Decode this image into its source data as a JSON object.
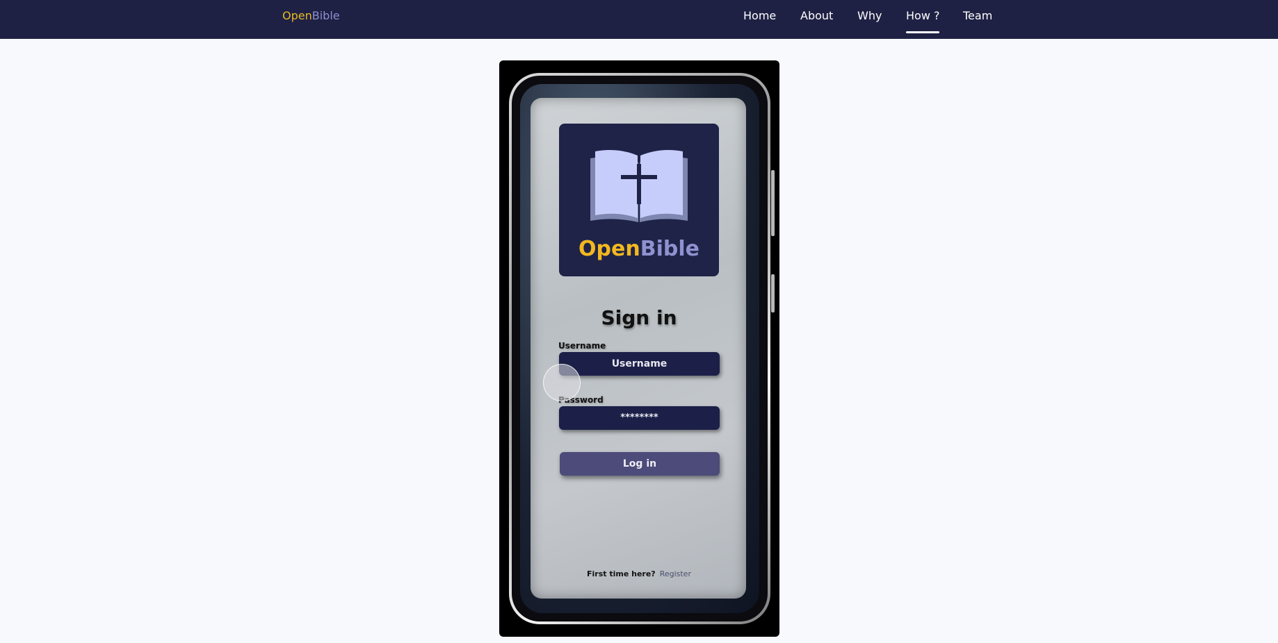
{
  "navbar": {
    "brand_part1": "Open",
    "brand_part2": "Bible",
    "links": [
      {
        "label": "Home"
      },
      {
        "label": "About"
      },
      {
        "label": "Why"
      },
      {
        "label": "How ?"
      },
      {
        "label": "Team"
      }
    ],
    "active_link": "How ?"
  },
  "phone_screen": {
    "logo_word_part1": "Open",
    "logo_word_part2": "Bible",
    "logo_icon": "open-bible-cross-icon",
    "title": "Sign in",
    "username_label": "Username",
    "username_placeholder": "Username",
    "password_label": "Password",
    "password_value": "********",
    "login_button": "Log in",
    "footer_question": "First time here?",
    "footer_link": "Register"
  },
  "colors": {
    "navbar_bg": "#1f2144",
    "brand_open": "#e8b923",
    "brand_bible": "#8f8fd0",
    "page_bg": "#f8f9fd",
    "field_bg": "#1c2048",
    "button_bg": "#4d4b7a"
  }
}
